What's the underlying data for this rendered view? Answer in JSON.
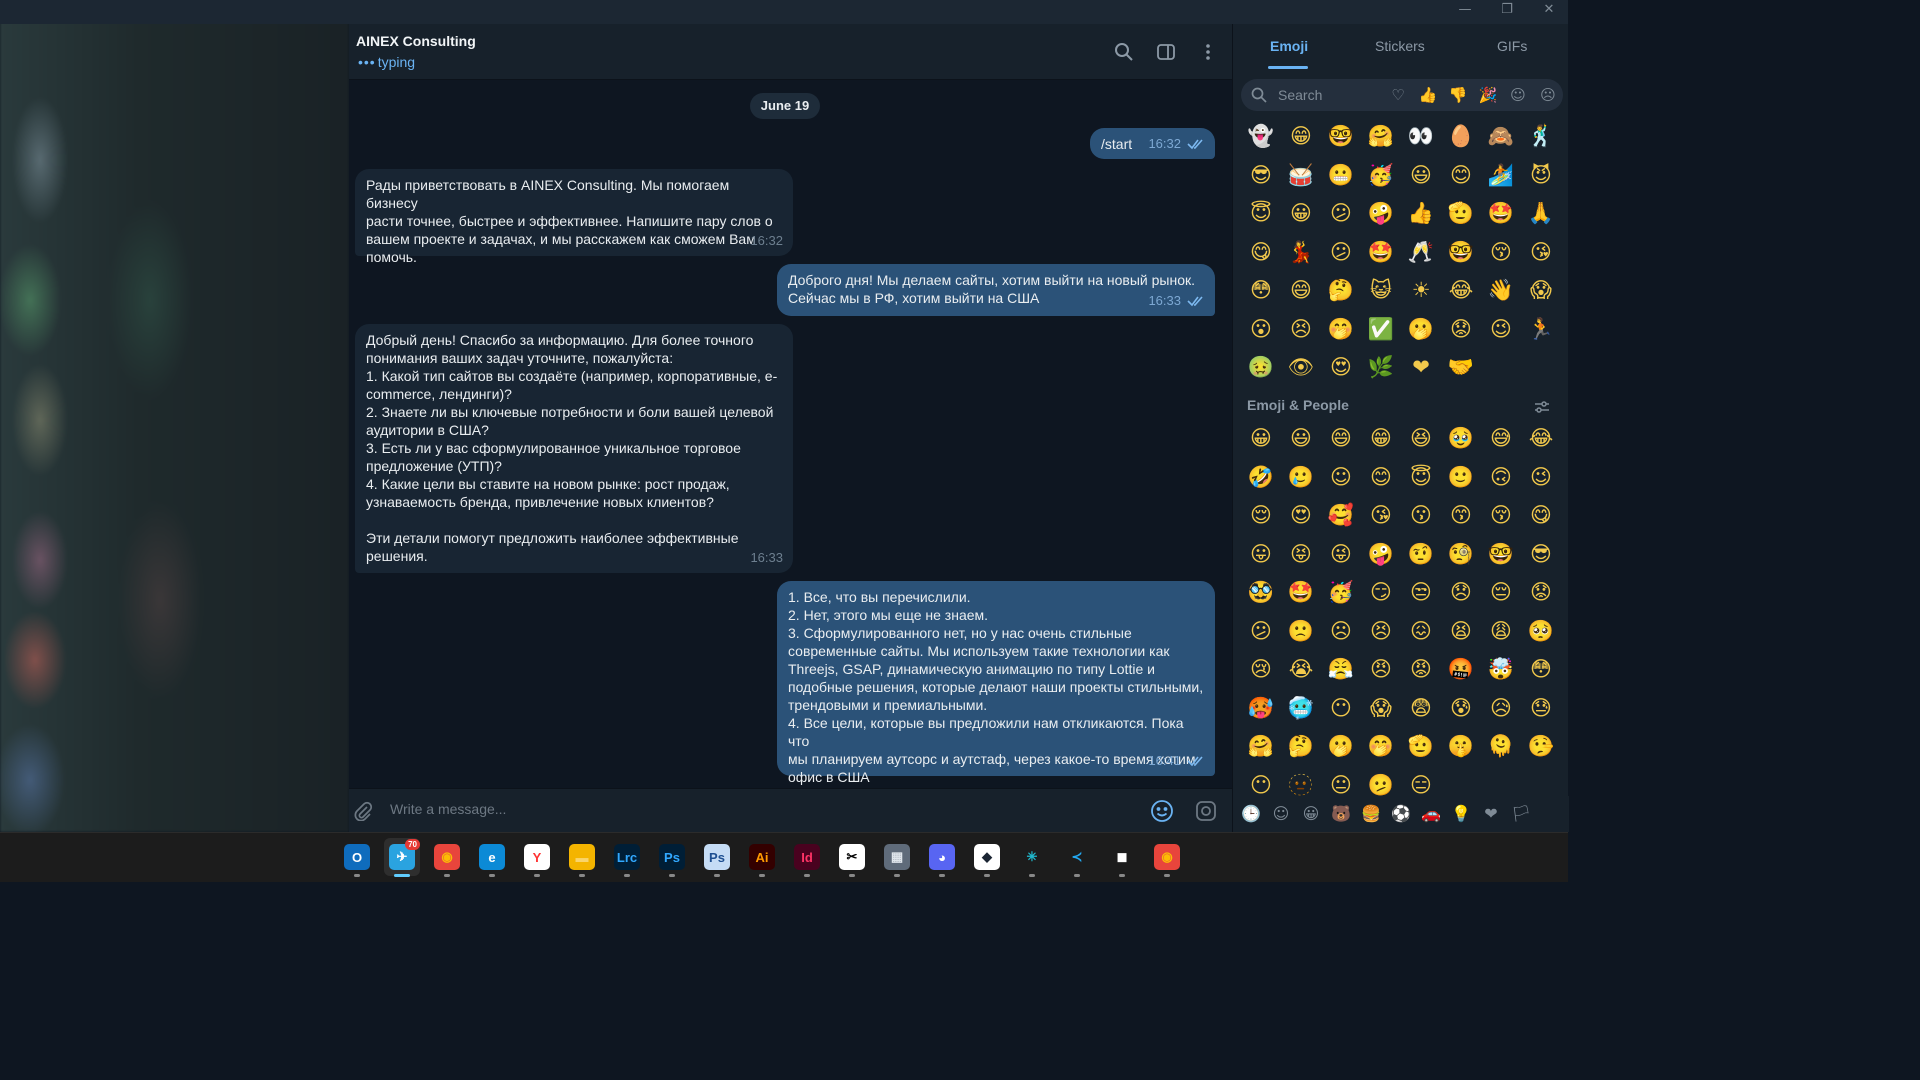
{
  "window": {
    "controls": [
      "—",
      "❐",
      "✕"
    ]
  },
  "chat": {
    "title": "AINEX Consulting",
    "status_dots": "•••",
    "status": "typing",
    "header_icons": [
      "search-icon",
      "sidebar-toggle-icon",
      "more-icon"
    ],
    "date_separator": "June 19",
    "messages": [
      {
        "direction": "out",
        "text": "/start",
        "time": "16:32",
        "read": true
      },
      {
        "direction": "in",
        "text": "Рады приветствовать в AINEX Consulting. Мы помогаем бизнесу\nрасти точнее, быстрее и эффективнее. Напишите пару слов о\nвашем проекте и задачах, и мы расскажем как сможем Вам\nпомочь.",
        "time": "16:32"
      },
      {
        "direction": "out",
        "text": "Доброго дня! Мы делаем сайты, хотим выйти на новый рынок.\nСейчас мы в РФ, хотим выйти на США",
        "time": "16:33",
        "read": true
      },
      {
        "direction": "in",
        "text": "Добрый день! Спасибо за информацию. Для более точного\nпонимания ваших задач уточните, пожалуйста:\n1. Какой тип сайтов вы создаёте (например, корпоративные, e-\ncommerce, лендинги)?\n2. Знаете ли вы ключевые потребности и боли вашей целевой\nаудитории в США?\n3. Есть ли у вас сформулированное уникальное торговое\nпредложение (УТП)?\n4. Какие цели вы ставите на новом рынке: рост продаж,\nузнаваемость бренда, привлечение новых клиентов?\n\nЭти детали помогут предложить наиболее эффективные\nрешения.",
        "time": "16:33"
      },
      {
        "direction": "out",
        "text": "1. Все, что вы перечислили.\n2. Нет, этого мы еще не знаем.\n3. Сформулированного нет, но у нас очень стильные\nсовременные сайты. Мы используем такие технологии как\nThreejs, GSAP, динамическую анимацию по типу Lottie и\nподобные решения, которые делают наши проекты стильными,\nтрендовыми и премиальными.\n4. Все цели, которые вы предложили нам откликаются. Пока что\nмы планируем аутсорс и аутстаф, через какое-то время хотим\nофис в США",
        "time": "16:41",
        "read": true
      }
    ],
    "composer_placeholder": "Write a message..."
  },
  "emoji_panel": {
    "tabs": [
      "Emoji",
      "Stickers",
      "GIFs"
    ],
    "active_tab": "Emoji",
    "search_placeholder": "Search",
    "search_categories": [
      "♡",
      "👍",
      "👎",
      "🎉",
      "☺",
      "☹"
    ],
    "recent": [
      "👻",
      "😁",
      "🤓",
      "🤗",
      "👀",
      "🥚",
      "🙈",
      "🕺",
      "😎",
      "🥁",
      "😬",
      "🥳",
      "😃",
      "😊",
      "🏄",
      "😈",
      "😇",
      "😀",
      "😕",
      "🤪",
      "👍",
      "🫡",
      "🤩",
      "🙏",
      "😋",
      "💃",
      "😕",
      "🤩",
      "🥂",
      "🤓",
      "😚",
      "😘",
      "😳",
      "😄",
      "🤔",
      "😺",
      "☀",
      "😂",
      "👋",
      "😱",
      "😮",
      "😣",
      "🤭",
      "✅",
      "🫢",
      "😟",
      "😉",
      "🏃",
      "🤢",
      "👁",
      "😍",
      "🌿",
      "❤",
      "🤝"
    ],
    "section_label": "Emoji & People",
    "people": [
      "😀",
      "😃",
      "😄",
      "😁",
      "😆",
      "🥹",
      "😅",
      "😂",
      "🤣",
      "🥲",
      "☺",
      "😊",
      "😇",
      "🙂",
      "🙃",
      "😉",
      "😌",
      "😍",
      "🥰",
      "😘",
      "😗",
      "😙",
      "😚",
      "😋",
      "😛",
      "😝",
      "😜",
      "🤪",
      "🤨",
      "🧐",
      "🤓",
      "😎",
      "🥸",
      "🤩",
      "🥳",
      "😏",
      "😒",
      "😞",
      "😔",
      "😟",
      "😕",
      "🙁",
      "☹",
      "😣",
      "😖",
      "😫",
      "😩",
      "🥺",
      "😢",
      "😭",
      "😤",
      "😠",
      "😡",
      "🤬",
      "🤯",
      "😳",
      "🥵",
      "🥶",
      "😶",
      "😱",
      "😨",
      "😰",
      "😥",
      "😓",
      "🤗",
      "🤔",
      "🫢",
      "🤭",
      "🫡",
      "🤫",
      "🫠",
      "🤥",
      "😶",
      "🫥",
      "😐",
      "🫤",
      "😑"
    ],
    "category_bar": [
      "🕒",
      "☺",
      "😀",
      "🐻",
      "🍔",
      "⚽",
      "🚗",
      "💡",
      "❤",
      "🏳"
    ]
  },
  "taskbar": {
    "apps": [
      {
        "name": "outlook",
        "label": "O",
        "color": "#0f6cbd",
        "text": "#ffffff"
      },
      {
        "name": "telegram",
        "label": "✈",
        "color": "#2aa3e0",
        "text": "#ffffff",
        "badge": "70",
        "active": true
      },
      {
        "name": "chrome",
        "label": "◉",
        "color": "#e8453c",
        "text": "#fbbc05"
      },
      {
        "name": "edge",
        "label": "e",
        "color": "#0c8ad6",
        "text": "#ffffff"
      },
      {
        "name": "yandex",
        "label": "Y",
        "color": "#ffffff",
        "text": "#ff3333"
      },
      {
        "name": "explorer",
        "label": "▬",
        "color": "#f4b400",
        "text": "#f9d46b"
      },
      {
        "name": "lightroom",
        "label": "Lrc",
        "color": "#001e36",
        "text": "#31a8ff"
      },
      {
        "name": "photoshop",
        "label": "Ps",
        "color": "#001e36",
        "text": "#31a8ff"
      },
      {
        "name": "photoshop-express",
        "label": "Ps",
        "color": "#c5dcf5",
        "text": "#1d4f91"
      },
      {
        "name": "illustrator",
        "label": "Ai",
        "color": "#330000",
        "text": "#ff9a00"
      },
      {
        "name": "indesign",
        "label": "Id",
        "color": "#49021f",
        "text": "#ff3366"
      },
      {
        "name": "capcut",
        "label": "✂",
        "color": "#ffffff",
        "text": "#000000"
      },
      {
        "name": "calculator",
        "label": "▦",
        "color": "#5f6b7a",
        "text": "#e0e6ec"
      },
      {
        "name": "discord",
        "label": "◕",
        "color": "#5865f2",
        "text": "#ffffff"
      },
      {
        "name": "app-cube",
        "label": "◆",
        "color": "#ffffff",
        "text": "#1b2533"
      },
      {
        "name": "perplexity",
        "label": "✳",
        "color": "#1c1c1c",
        "text": "#20b8cd"
      },
      {
        "name": "vscode",
        "label": "≺",
        "color": "#1c1c1c",
        "text": "#23a9f2"
      },
      {
        "name": "app-box",
        "label": "◼",
        "color": "#1c1c1c",
        "text": "#ffffff"
      },
      {
        "name": "chrome-2",
        "label": "◉",
        "color": "#e8453c",
        "text": "#fbbc05"
      }
    ]
  }
}
